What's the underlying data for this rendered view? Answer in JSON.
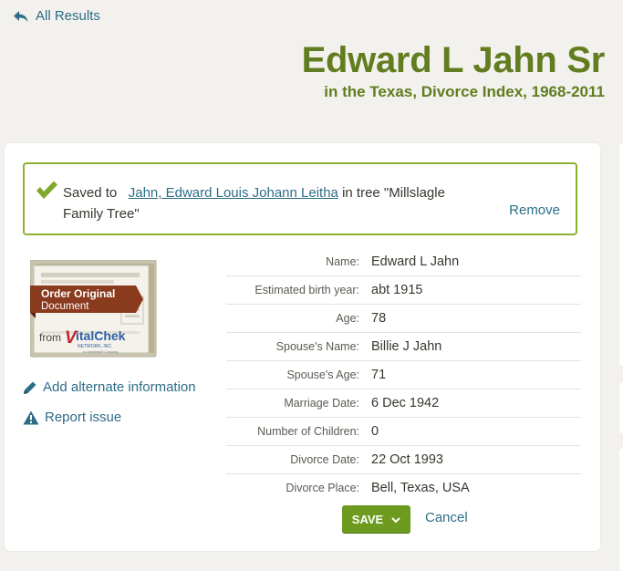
{
  "nav": {
    "back_label": "All Results",
    "back_icon": "reply-arrow-icon"
  },
  "header": {
    "title": "Edward L Jahn Sr",
    "subtitle": "in the Texas, Divorce Index, 1968-2011"
  },
  "saved": {
    "prefix": "Saved to",
    "person_link": "Jahn, Edward Louis Johann Leitha",
    "suffix": "in tree \"Millslagle Family Tree\"",
    "remove_label": "Remove",
    "icon": "checkmark-icon"
  },
  "document": {
    "order_line1": "Order Original",
    "order_line2": "Document",
    "from_label": "from",
    "brand_v": "V",
    "brand_rest": "italChek",
    "brand_network": "NETWORK, INC.",
    "brand_tagline": "a LexisNexis® Company"
  },
  "actions": {
    "add_alternate": "Add alternate information",
    "report_issue": "Report issue",
    "save_label": "SAVE",
    "cancel_label": "Cancel"
  },
  "facts": [
    {
      "label": "Name:",
      "value": "Edward L Jahn"
    },
    {
      "label": "Estimated birth year:",
      "value": "abt 1915"
    },
    {
      "label": "Age:",
      "value": "78"
    },
    {
      "label": "Spouse's Name:",
      "value": "Billie J Jahn"
    },
    {
      "label": "Spouse's Age:",
      "value": "71"
    },
    {
      "label": "Marriage Date:",
      "value": "6 Dec 1942"
    },
    {
      "label": "Number of Children:",
      "value": "0"
    },
    {
      "label": "Divorce Date:",
      "value": "22 Oct 1993"
    },
    {
      "label": "Divorce Place:",
      "value": "Bell, Texas, USA"
    }
  ],
  "colors": {
    "brand_green": "#617d1f",
    "link_blue": "#2d6d87",
    "save_green": "#6d9b1f",
    "saved_border": "#8bb130",
    "order_banner": "#8a3a1d"
  }
}
